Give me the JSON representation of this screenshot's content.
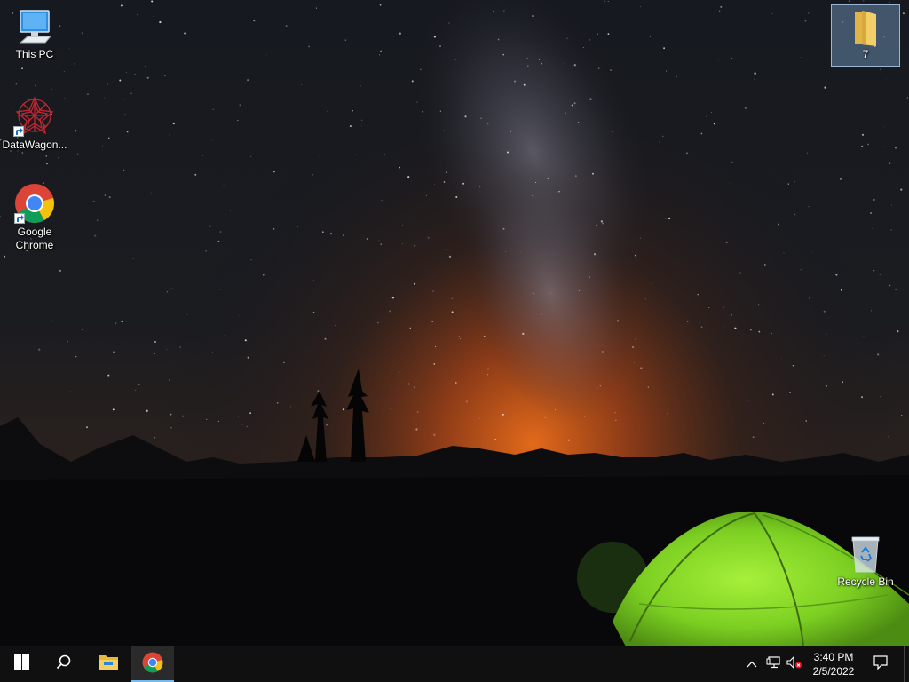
{
  "desktop": {
    "icons": [
      {
        "label": "This PC",
        "icon": "computer-icon"
      },
      {
        "label": "DataWagon...",
        "icon": "datawagon-app-icon"
      },
      {
        "label": "Google\nChrome",
        "label_line1": "Google",
        "label_line2": "Chrome",
        "icon": "chrome-icon"
      },
      {
        "label": "7",
        "icon": "folder-icon"
      },
      {
        "label": "Recycle Bin",
        "icon": "recycle-bin-icon"
      }
    ]
  },
  "taskbar": {
    "start": {
      "icon": "windows-logo-icon"
    },
    "search": {
      "icon": "search-icon"
    },
    "pinned": [
      {
        "name": "File Explorer",
        "icon": "file-explorer-icon"
      },
      {
        "name": "Google Chrome",
        "icon": "chrome-icon",
        "active": true
      }
    ],
    "tray": {
      "overflow_icon": "chevron-up-icon",
      "network_icon": "network-icon",
      "volume_icon": "volume-muted-icon"
    },
    "clock": {
      "time": "3:40 PM",
      "date": "2/5/2022"
    },
    "notifications_icon": "action-center-icon"
  },
  "colors": {
    "taskbar_bg": "#101010",
    "active_indicator": "#76b9ed",
    "tent_green": "#8be22a",
    "horizon_glow": "#e06a1c"
  }
}
